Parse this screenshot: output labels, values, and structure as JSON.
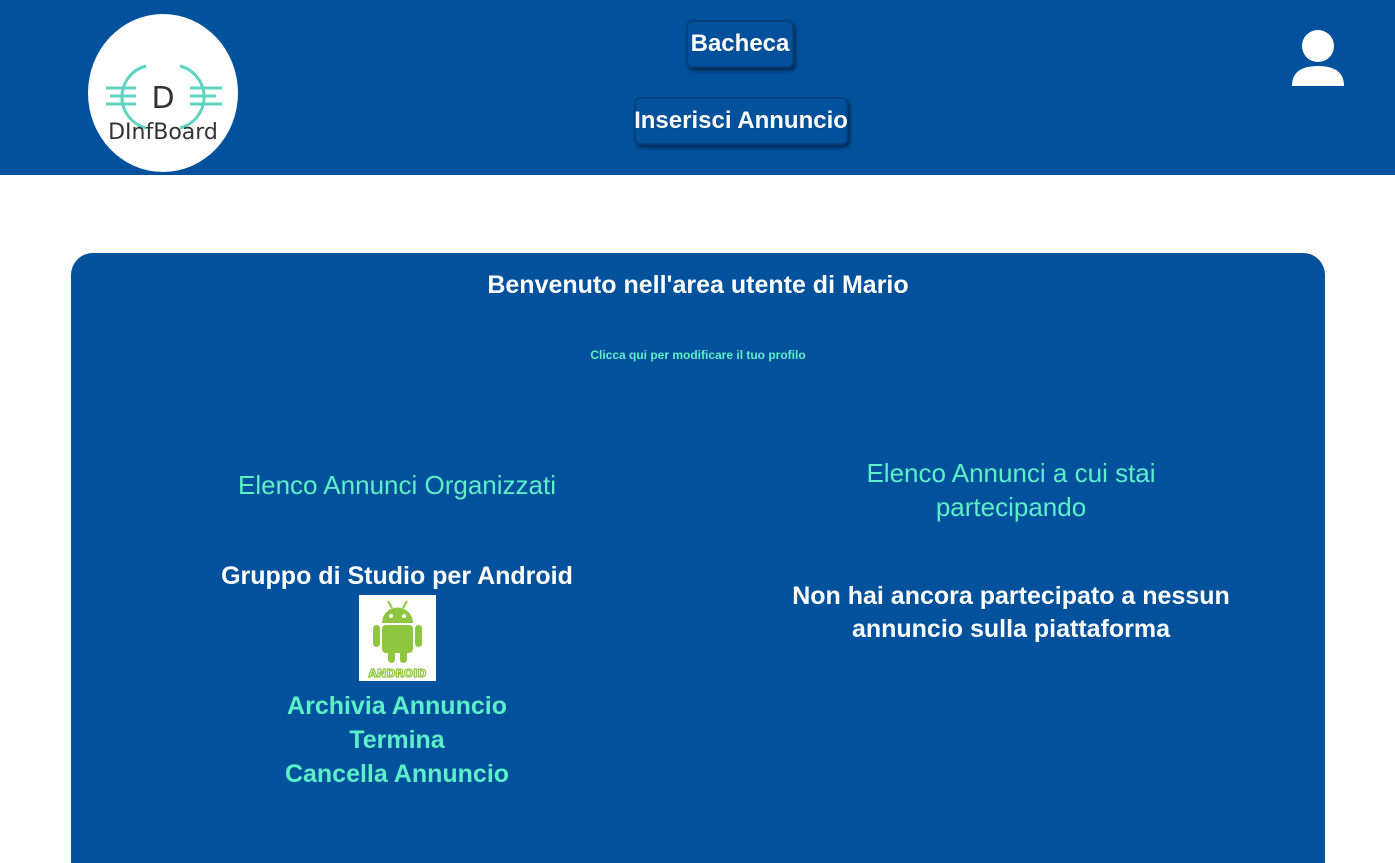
{
  "header": {
    "logo_text": "DInfBoard",
    "logo_letter": "D",
    "nav": {
      "bacheca": "Bacheca",
      "inserisci": "Inserisci Annuncio"
    }
  },
  "main": {
    "welcome": "Benvenuto nell'area utente di Mario",
    "edit_profile_link": "Clicca qui per modificare il tuo profilo",
    "organized": {
      "title": "Elenco Annunci Organizzati",
      "announcements": [
        {
          "title": "Gruppo di Studio per Android",
          "image_label": "ANDROID",
          "actions": [
            "Archivia Annuncio",
            "Termina",
            "Cancella Annuncio"
          ]
        }
      ]
    },
    "participating": {
      "title_line1": "Elenco Annunci a cui stai",
      "title_line2": "partecipando",
      "empty_line1": "Non hai ancora partecipato a nessun",
      "empty_line2": "annuncio sulla piattaforma"
    }
  },
  "colors": {
    "primary": "#02519c",
    "accent": "#5df0c8",
    "text": "#ffffff",
    "android_green": "#8fc63f"
  },
  "icons": {
    "user": "user-icon",
    "android": "android-icon"
  }
}
